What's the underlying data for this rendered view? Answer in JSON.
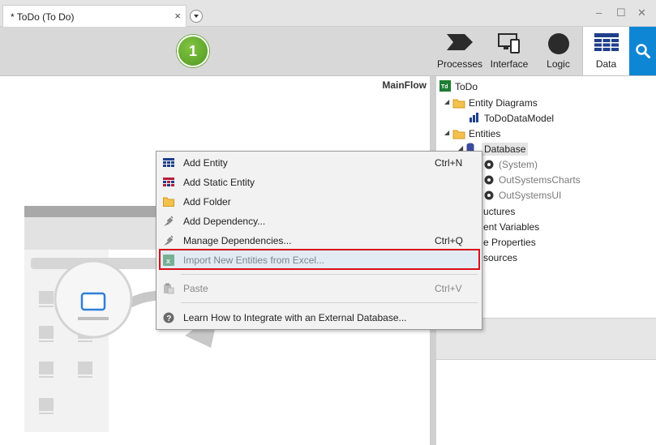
{
  "tabs": {
    "document_title": "* ToDo (To Do)",
    "close_glyph": "×"
  },
  "window_controls": {
    "minimize": "–",
    "restore": "☐",
    "close": "✕"
  },
  "step_badge": "1",
  "toolbar": {
    "processes_label": "Processes",
    "interface_label": "Interface",
    "logic_label": "Logic",
    "data_label": "Data",
    "search_icon": "search-icon"
  },
  "canvas": {
    "flow_name": "MainFlow"
  },
  "tree": {
    "root": "ToDo",
    "entity_diagrams": "Entity Diagrams",
    "data_model": "ToDoDataModel",
    "entities": "Entities",
    "database": "Database",
    "system": "(System)",
    "charts": "OutSystemsCharts",
    "ui": "OutSystemsUI",
    "structures": "uctures",
    "client_vars": "ent Variables",
    "site_props": "e Properties",
    "resources": "sources"
  },
  "context_menu": {
    "items": [
      {
        "label": "Add Entity",
        "shortcut": "Ctrl+N",
        "icon": "entity-icon"
      },
      {
        "label": "Add Static Entity",
        "shortcut": "",
        "icon": "static-entity-icon"
      },
      {
        "label": "Add Folder",
        "shortcut": "",
        "icon": "folder-icon"
      },
      {
        "label": "Add Dependency...",
        "shortcut": "",
        "icon": "plug-icon"
      },
      {
        "label": "Manage Dependencies...",
        "shortcut": "Ctrl+Q",
        "icon": "plug-icon"
      },
      {
        "label": "Import New Entities from Excel...",
        "shortcut": "",
        "icon": "excel-icon"
      },
      {
        "label": "Paste",
        "shortcut": "Ctrl+V",
        "icon": "paste-icon"
      },
      {
        "label": "Learn How to Integrate with an External Database...",
        "shortcut": "",
        "icon": "help-icon"
      }
    ]
  },
  "colors": {
    "accent": "#0e86d4",
    "highlight_border": "#d90f1a",
    "step_badge": "#5fa52c"
  }
}
